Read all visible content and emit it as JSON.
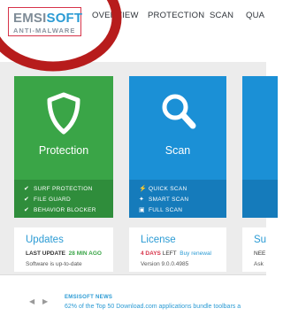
{
  "logo": {
    "brand_main": "EMSI",
    "brand_accent": "SOFT",
    "brand_sub": "ANTI-MALWARE"
  },
  "nav": {
    "items": [
      "OVERVIEW",
      "PROTECTION",
      "SCAN",
      "QUA"
    ]
  },
  "tiles": {
    "protection": {
      "title": "Protection",
      "icon": "shield-icon",
      "features": [
        "SURF PROTECTION",
        "FILE GUARD",
        "BEHAVIOR BLOCKER"
      ]
    },
    "scan": {
      "title": "Scan",
      "icon": "magnifier-icon",
      "actions": [
        "QUICK SCAN",
        "SMART SCAN",
        "FULL SCAN"
      ]
    }
  },
  "cards": {
    "updates": {
      "title": "Updates",
      "last_update_label": "LAST UPDATE",
      "last_update_value": "28 MIN AGO",
      "status": "Software is up-to-date"
    },
    "license": {
      "title": "License",
      "days_left_value": "4 DAYS",
      "days_left_label": "LEFT",
      "renew_link": "Buy renewal",
      "version": "Version 9.0.0.4985"
    },
    "third": {
      "title": "Su",
      "line1": "NEE",
      "line2": "Ask"
    }
  },
  "news": {
    "heading": "EMSISOFT NEWS",
    "text": "62% of the Top 50 Download.com applications bundle toolbars a"
  },
  "colors": {
    "green": "#3aa547",
    "blue": "#1b90d6",
    "accent_red": "#d7344a",
    "link_blue": "#2b9bd4"
  }
}
